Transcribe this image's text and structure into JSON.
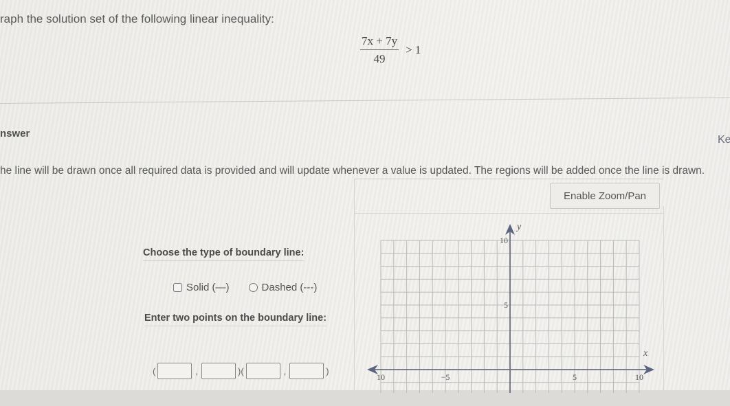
{
  "question": {
    "prompt": "raph the solution set of the following linear inequality:",
    "equation": {
      "numerator": "7x + 7y",
      "denominator": "49",
      "relation": "> 1"
    }
  },
  "answer": {
    "label": "nswer",
    "keypad_label": "Ke",
    "instructions": "he line will be drawn once all required data is provided and will update whenever a value is updated. The regions will be added once the line is drawn.",
    "zoom_button": "Enable Zoom/Pan",
    "boundary": {
      "title": "Choose the type of boundary line:",
      "options": [
        {
          "label": "Solid (—)",
          "selected": false
        },
        {
          "label": "Dashed (---)",
          "selected": false
        }
      ]
    },
    "points": {
      "title": "Enter two points on the boundary line:",
      "open_paren": "(",
      "comma": ",",
      "close_paren": ")",
      "point1": {
        "x": "",
        "y": ""
      },
      "point2": {
        "x": "",
        "y": ""
      }
    }
  },
  "graph": {
    "x_label": "x",
    "y_label": "y",
    "x_range": [
      -10,
      10
    ],
    "y_range_visible": [
      -2,
      10
    ],
    "grid_step": 1,
    "x_tick_labels": [
      {
        "value": -10,
        "text": "10"
      },
      {
        "value": -5,
        "text": "−5"
      },
      {
        "value": 5,
        "text": "5"
      },
      {
        "value": 10,
        "text": "10"
      }
    ],
    "y_tick_labels": [
      {
        "value": 10,
        "text": "10"
      },
      {
        "value": 5,
        "text": "5"
      }
    ],
    "colors": {
      "grid": "#b9b9bb",
      "axis": "#6b6f7d",
      "arrow": "#5b6580"
    }
  }
}
